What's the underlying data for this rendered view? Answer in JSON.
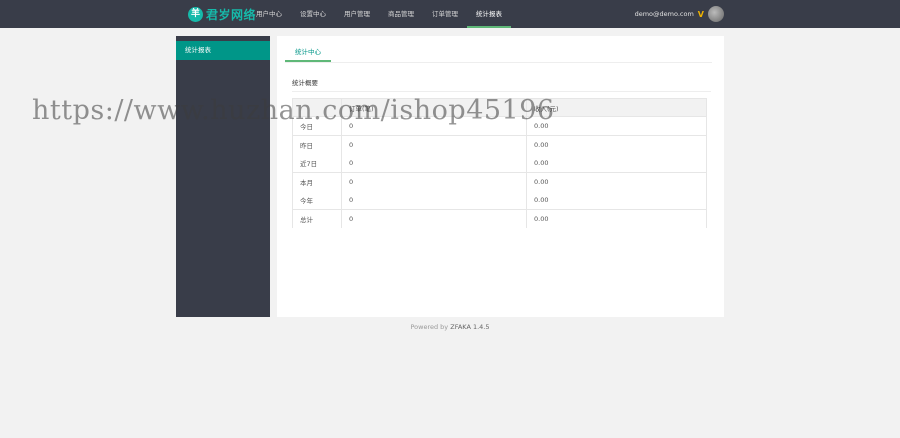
{
  "header": {
    "logo_icon": "羊",
    "logo_text": "君岁网络",
    "nav": [
      "用户中心",
      "设置中心",
      "用户管理",
      "商品管理",
      "订单管理",
      "统计报表"
    ],
    "active_nav": 5,
    "user_email": "demo@demo.com",
    "user_badge": "V",
    "accent": "#5fb878"
  },
  "sidebar": {
    "items": [
      {
        "label": "统计报表",
        "active": true
      }
    ],
    "bg": "#393d49",
    "active_bg": "#009688"
  },
  "main": {
    "tab": "统计中心",
    "section_title": "统计概要",
    "table": {
      "headers": [
        "",
        "订单(笔)",
        "收入(元)"
      ],
      "rows": [
        [
          "今日",
          "0",
          "0.00"
        ],
        [
          "昨日",
          "0",
          "0.00"
        ],
        [
          "近7日",
          "0",
          "0.00"
        ],
        [
          "本月",
          "0",
          "0.00"
        ],
        [
          "今年",
          "0",
          "0.00"
        ],
        [
          "总计",
          "0",
          "0.00"
        ]
      ]
    }
  },
  "footer": {
    "powered_by": "Powered by",
    "version": "ZFAKA 1.4.5"
  },
  "watermark": "https://www.huzhan.com/ishop45196"
}
